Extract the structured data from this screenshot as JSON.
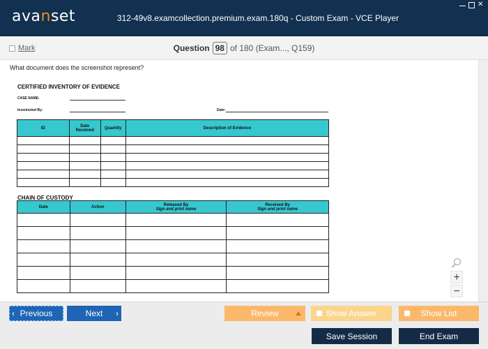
{
  "app": {
    "logo_prefix": "ava",
    "logo_accent": "n",
    "logo_suffix": "set",
    "window_title": "312-49v8.examcollection.premium.exam.180q - Custom Exam - VCE Player"
  },
  "header": {
    "mark_label": "Mark",
    "question_word": "Question",
    "question_number": "98",
    "question_of": "of 180 (Exam..., Q159)"
  },
  "question": {
    "text": "What document does the screenshot represent?"
  },
  "document": {
    "title": "CERTIFIED INVENTORY OF EVIDENCE",
    "case_name_label": "CASE NAME:",
    "inventoried_by_label": "Inventoried By:",
    "date_label": "Date:",
    "inventory_headers": [
      "ID",
      "Date\nReceived",
      "Quantity",
      "Description of Evidence"
    ],
    "inventory_rows": 6,
    "custody_title": "CHAIN OF CUSTODY",
    "custody_headers": [
      {
        "main": "Date",
        "sub": ""
      },
      {
        "main": "Action",
        "sub": ""
      },
      {
        "main": "Released By",
        "sub": "Sign and print name"
      },
      {
        "main": "Received By",
        "sub": "Sign and print name"
      }
    ],
    "custody_rows": 6
  },
  "footer": {
    "previous_label": "Previous",
    "next_label": "Next",
    "review_label": "Review",
    "show_answer_label": "Show Answer",
    "show_list_label": "Show List",
    "save_session_label": "Save Session",
    "end_exam_label": "End Exam"
  },
  "colors": {
    "titlebar": "#12304f",
    "logo_accent": "#f28b1a",
    "nav_blue": "#1e65b5",
    "orange": "#fbb86b",
    "table_header": "#37c8cf",
    "dark_button": "#142b47"
  },
  "icons": {
    "zoom": "magnifier-icon",
    "zoom_in": "plus-icon",
    "zoom_out": "minus-icon",
    "prev": "chevron-left-icon",
    "next": "chevron-right-icon",
    "review": "triangle-up-icon"
  }
}
